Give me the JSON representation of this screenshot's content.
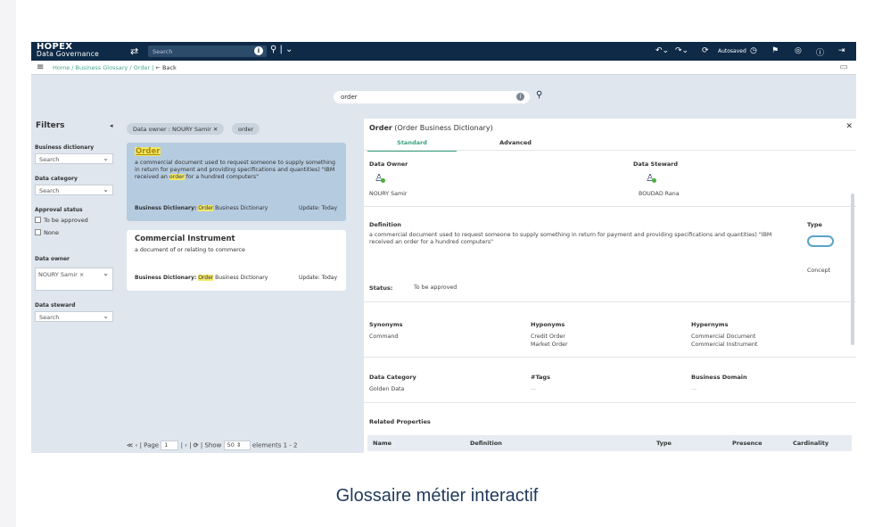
{
  "topbar": {
    "logo_line1": "HOPEX",
    "logo_line2": "Data Governance",
    "search_placeholder": "Search",
    "autosaved": "Autosaved"
  },
  "breadcrumb": {
    "path": "Home / Business Glossary / Order |",
    "back": "← Back"
  },
  "main_search": {
    "value": "order"
  },
  "filters": {
    "title": "Filters",
    "business_dictionary_label": "Business dictionary",
    "business_dictionary_value": "Search",
    "data_category_label": "Data category",
    "data_category_value": "Search",
    "approval_status_label": "Approval status",
    "approval_options": [
      "To be approved",
      "None"
    ],
    "data_owner_label": "Data owner",
    "data_owner_chip": "NOURY Samir ×",
    "data_steward_label": "Data steward",
    "data_steward_value": "Search"
  },
  "results": {
    "chip_owner": "Data owner : NOURY Samir",
    "chip_term": "order",
    "cards": [
      {
        "title": "Order",
        "desc_pre": "a commercial document used to request someone to supply something in return for payment and providing specifications and quantities) \"IBM received an ",
        "desc_hl": "order",
        "desc_post": " for a hundred computers\"",
        "dict_label": "Business Dictionary:",
        "dict_hl": "Order",
        "dict_rest": " Business Dictionary",
        "update": "Update:  Today"
      },
      {
        "title": "Commercial Instrument",
        "desc": "a document of or relating to commerce",
        "dict_label": "Business Dictionary:",
        "dict_hl": "Order",
        "dict_rest": " Business Dictionary",
        "update": "Update:  Today"
      }
    ],
    "pager": {
      "nav_first": "≪  ‹  |",
      "page_label": "Page",
      "page_value": "1",
      "nav_next": "|  ›  |",
      "show_label": "|  Show",
      "show_value": "50",
      "elements": "elements   1 - 2"
    }
  },
  "detail": {
    "title_bold": "Order",
    "title_rest": " (Order Business Dictionary)",
    "tabs": [
      "Standard",
      "Advanced"
    ],
    "data_owner_label": "Data Owner",
    "data_owner_value": "NOURY Samir",
    "data_steward_label": "Data Steward",
    "data_steward_value": "BOUDAD Rana",
    "definition_label": "Definition",
    "definition_text": "a commercial document used to request someone to supply something in return for payment and providing specifications and quantities) \"IBM received an order for a hundred computers\"",
    "type_label": "Type",
    "type_value": "Concept",
    "status_label": "Status:",
    "status_value": "To be approved",
    "synonyms_label": "Synonyms",
    "synonyms": "Command",
    "hyponyms_label": "Hyponyms",
    "hyponym_1": "Credit Order",
    "hyponym_2": "Market Order",
    "hypernyms_label": "Hypernyms",
    "hypernym_1": "Commercial Document",
    "hypernym_2": "Commercial Instrument",
    "data_category_label": "Data Category",
    "data_category_value": "Golden Data",
    "tags_label": "#Tags",
    "tags_value": "—",
    "business_domain_label": "Business Domain",
    "business_domain_value": "—",
    "related_label": "Related Properties",
    "columns": [
      "Name",
      "Definition",
      "Type",
      "Presence",
      "Cardinality"
    ]
  },
  "caption": "Glossaire métier interactif",
  "colors": {
    "topbar": "#0e2a47",
    "accent": "#3aa07e",
    "highlight": "#f2e96b",
    "selected_card": "#b5cbe0"
  }
}
